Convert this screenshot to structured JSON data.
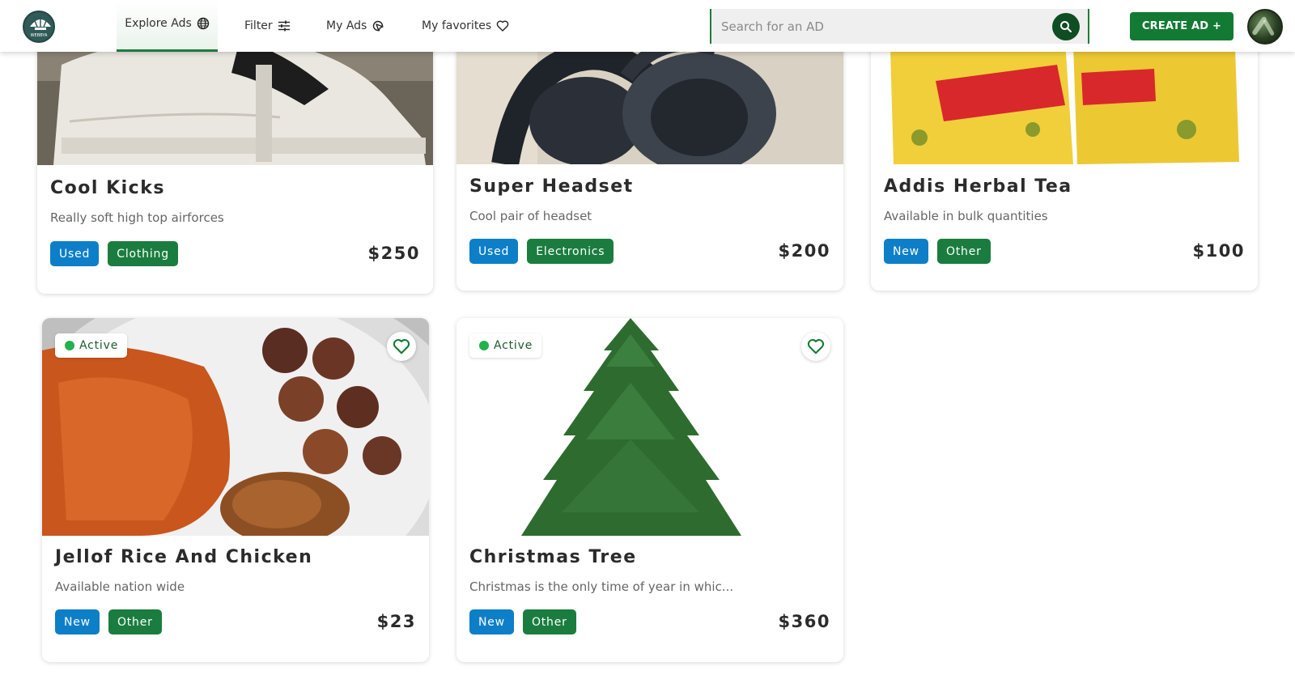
{
  "header": {
    "logo_text": "WEBBYA",
    "nav": {
      "explore": "Explore Ads",
      "filter": "Filter",
      "my_ads": "My Ads",
      "favorites": "My favorites"
    },
    "search_placeholder": "Search for an AD",
    "create_label": "CREATE AD +"
  },
  "cards": [
    {
      "title": "Cool Kicks",
      "description": "Really soft high top airforces",
      "condition": "Used",
      "category": "Clothing",
      "price": "$250"
    },
    {
      "title": "Super Headset",
      "description": "Cool pair of headset",
      "condition": "Used",
      "category": "Electronics",
      "price": "$200"
    },
    {
      "title": "Addis Herbal Tea",
      "description": "Available in bulk quantities",
      "condition": "New",
      "category": "Other",
      "price": "$100"
    },
    {
      "title": "Jellof Rice And Chicken",
      "description": "Available nation wide",
      "condition": "New",
      "category": "Other",
      "price": "$23",
      "status": "Active"
    },
    {
      "title": "Christmas Tree",
      "description": "Christmas is the only time of year in whic...",
      "condition": "New",
      "category": "Other",
      "price": "$360",
      "status": "Active"
    }
  ],
  "colors": {
    "brand_green": "#137a33",
    "tag_blue": "#0d7fc8",
    "tag_green": "#1a7d3f"
  },
  "icons": [
    "globe-icon",
    "sliders-icon",
    "cursor-click-icon",
    "heart-icon",
    "search-icon"
  ]
}
